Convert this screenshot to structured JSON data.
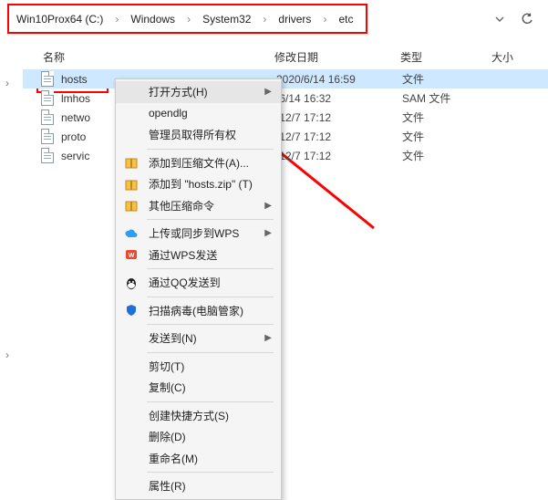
{
  "breadcrumb": [
    "Win10Prox64 (C:)",
    "Windows",
    "System32",
    "drivers",
    "etc"
  ],
  "columns": {
    "name": "名称",
    "date": "修改日期",
    "type": "类型",
    "size": "大小"
  },
  "files": [
    {
      "name": "hosts",
      "date": "2020/6/14 16:59",
      "type": "文件",
      "selected": true
    },
    {
      "name": "lmhos",
      "date": "/6/14 16:32",
      "type": "SAM 文件",
      "selected": false
    },
    {
      "name": "netwo",
      "date": "/12/7 17:12",
      "type": "文件",
      "selected": false
    },
    {
      "name": "proto",
      "date": "/12/7 17:12",
      "type": "文件",
      "selected": false
    },
    {
      "name": "servic",
      "date": "/12/7 17:12",
      "type": "文件",
      "selected": false
    }
  ],
  "menu": {
    "open_with": "打开方式(H)",
    "opendlg": "opendlg",
    "admin_take": "管理员取得所有权",
    "add_archive": "添加到压缩文件(A)...",
    "add_hosts_zip": "添加到 \"hosts.zip\" (T)",
    "other_compress": "其他压缩命令",
    "upload_wps": "上传或同步到WPS",
    "send_wps": "通过WPS发送",
    "send_qq": "通过QQ发送到",
    "scan_av": "扫描病毒(电脑管家)",
    "send_to": "发送到(N)",
    "cut": "剪切(T)",
    "copy": "复制(C)",
    "shortcut": "创建快捷方式(S)",
    "delete": "删除(D)",
    "rename": "重命名(M)",
    "properties": "属性(R)"
  }
}
